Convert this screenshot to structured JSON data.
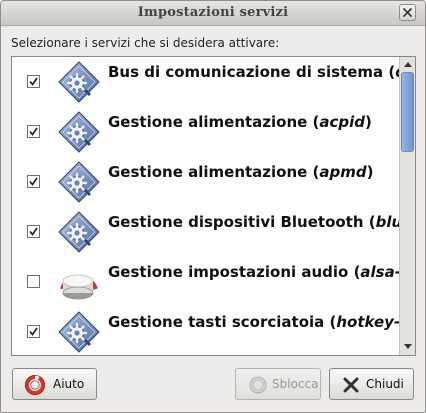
{
  "window": {
    "title": "Impostazioni servizi"
  },
  "instructions": "Selezionare i servizi che si desidera attivare:",
  "services": [
    {
      "checked": true,
      "label": "Bus di comunicazione di sistema (",
      "name": "dbus",
      "icon": "service-gear-icon"
    },
    {
      "checked": true,
      "label": "Gestione alimentazione (",
      "name": "acpid",
      "suffix": ")",
      "icon": "service-gear-icon"
    },
    {
      "checked": true,
      "label": "Gestione alimentazione (",
      "name": "apmd",
      "suffix": ")",
      "icon": "service-gear-icon"
    },
    {
      "checked": true,
      "label": "Gestione dispositivi Bluetooth (",
      "name": "bluetooth",
      "icon": "service-gear-icon"
    },
    {
      "checked": false,
      "label": "Gestione impostazioni audio (",
      "name": "alsa-utils",
      "icon": "audio-knob-icon"
    },
    {
      "checked": true,
      "label": "Gestione tasti scorciatoia (",
      "name": "hotkey-setup",
      "icon": "service-gear-icon"
    }
  ],
  "scrollbar": {
    "position": 0.0,
    "visible_fraction": 0.3
  },
  "buttons": {
    "help": "Aiuto",
    "unlock": "Sblocca",
    "close": "Chiudi"
  }
}
